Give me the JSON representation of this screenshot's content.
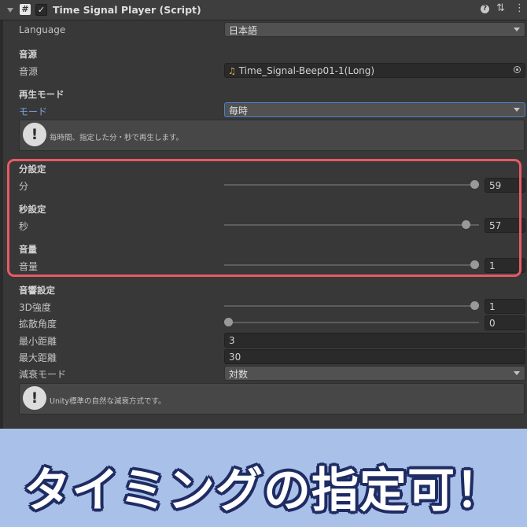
{
  "header": {
    "title": "Time Signal Player (Script)",
    "script_icon": "#"
  },
  "language": {
    "label": "Language",
    "value": "日本語"
  },
  "source_section": {
    "title": "音源",
    "label": "音源",
    "value": "Time_Signal-Beep01-1(Long)",
    "icon": "audio-clip-icon"
  },
  "mode_section": {
    "title": "再生モード",
    "label": "モード",
    "value": "毎時"
  },
  "help1": {
    "text": "毎時間、指定した分・秒で再生します。"
  },
  "minute_section": {
    "title": "分設定",
    "label": "分",
    "value": "59",
    "slider_fraction": 1.0
  },
  "second_section": {
    "title": "秒設定",
    "label": "秒",
    "value": "57",
    "slider_fraction": 0.966
  },
  "volume_section": {
    "title": "音量",
    "label": "音量",
    "value": "1",
    "slider_fraction": 1.0
  },
  "sound_section": {
    "title": "音響設定",
    "blend_label": "3D強度",
    "blend_value": "1",
    "blend_fraction": 1.0,
    "spread_label": "拡散角度",
    "spread_value": "0",
    "spread_fraction": 0.0,
    "min_label": "最小距離",
    "min_value": "3",
    "max_label": "最大距離",
    "max_value": "30",
    "rolloff_label": "減衰モード",
    "rolloff_value": "対数"
  },
  "help2": {
    "text": "Unity標準の自然な減衰方式です。"
  },
  "banner": {
    "text": "タイミングの指定可！"
  },
  "colors": {
    "highlight": "#e85a64",
    "banner_bg": "#a9c1e9",
    "banner_outline": "#1f2c63",
    "accent_blue": "#4a83c9"
  }
}
